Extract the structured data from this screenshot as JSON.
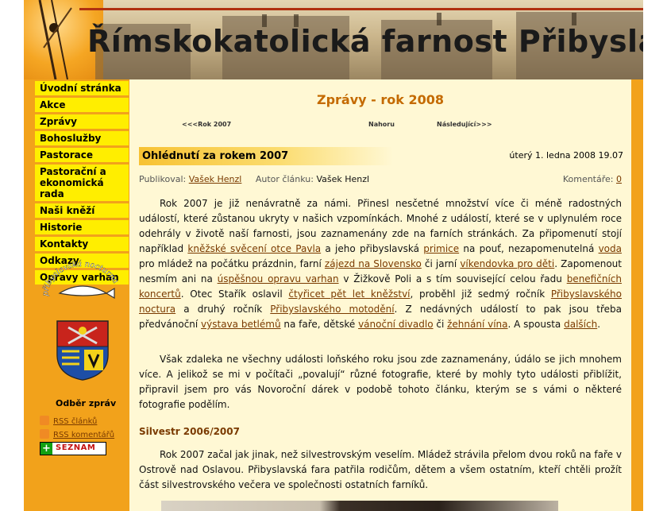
{
  "banner": {
    "title": "Římskokatolická farnost Přibyslav"
  },
  "nav": {
    "items": [
      {
        "label": "Úvodní stránka"
      },
      {
        "label": "Akce"
      },
      {
        "label": "Zprávy"
      },
      {
        "label": "Bohoslužby"
      },
      {
        "label": "Pastorace"
      },
      {
        "label": "Pastorační a ekonomická rada"
      },
      {
        "label": "Naši kněží"
      },
      {
        "label": "Historie"
      },
      {
        "label": "Kontakty"
      },
      {
        "label": "Odkazy"
      },
      {
        "label": "Opravy varhan"
      }
    ],
    "logo_text": "přibyslavská nocturna",
    "feeds_title": "Odběr zpráv",
    "feed_articles": "RSS článků",
    "feed_comments": "RSS komentářů",
    "seznam": "SEZNAM"
  },
  "content": {
    "heading": "Zprávy - rok 2008",
    "prev": "<<<Rok 2007",
    "up": "Nahoru",
    "next": "Následující>>>",
    "article": {
      "title": "Ohlédnutí za rokem 2007",
      "date": "úterý 1. ledna 2008 19.07",
      "published_label": "Publikoval:",
      "published_by": "Vašek Henzl",
      "author_label": "Autor článku:",
      "author": "Vašek Henzl",
      "comments_label": "Komentáře:",
      "comments_count": "0"
    },
    "p1": {
      "t1": "Rok 2007 je již nenávratně za námi. Přinesl nesčetné množství více či méně radostných událostí, které zůstanou ukryty v našich vzpomínkách. Mnohé z událostí, které se v uplynulém roce odehrály v životě naší farnosti, jsou zaznamenány zde na farních stránkách. Za připomenutí stojí například ",
      "l1": "kněžské svěcení otce Pavla",
      "t2": " a jeho přibyslavská ",
      "l2": "primice",
      "t3": " na pouť, nezapomenutelná ",
      "l3": "voda",
      "t4": " pro mládež na počátku prázdnin, farní ",
      "l4": "zájezd na Slovensko",
      "t5": " či jarní ",
      "l5": "víkendovka pro děti",
      "t6": ". Zapomenout nesmím ani na ",
      "l6": "úspěšnou opravu varhan",
      "t7": " v Žižkově Poli a s tím související celou řadu ",
      "l7": "benefičních",
      "t8": " ",
      "l8": "koncertů",
      "t9": ". Otec Stařík oslavil ",
      "l9": "čtyřicet pět let kněžství",
      "t10": ", proběhl již sedmý ročník ",
      "l10": "Přibyslavského noctura",
      "t11": " a druhý ročník ",
      "l11": "Přibyslavského motodění",
      "t12": ". Z nedávných událostí to pak jsou třeba předvánoční ",
      "l12": "výstava betlémů",
      "t13": " na faře, dětské ",
      "l13": "vánoční divadlo",
      "t14": " či ",
      "l14": "žehnání vína",
      "t15": ". A spousta ",
      "l15": "dalších",
      "t16": "."
    },
    "p2": "Však zdaleka ne všechny události loňského roku jsou zde zaznamenány, údálo se jich mnohem více. A jelikož se mi v počítači „povalují“ různé fotografie, které by mohly tyto události přiblížit, připravil jsem pro vás Novoroční dárek v podobě tohoto článku, kterým se s vámi o některé fotografie podělím.",
    "section": "Silvestr 2006/2007",
    "p3": "Rok 2007 začal jak jinak, než silvestrovským veselím. Mládež strávila přelom dvou roků na faře v Ostrově nad Oslavou. Přibyslavská fara patřila rodičům, dětem a všem ostatním, kteří chtěli prožít část silvestrovského večera ve společnosti ostatních farníků."
  }
}
